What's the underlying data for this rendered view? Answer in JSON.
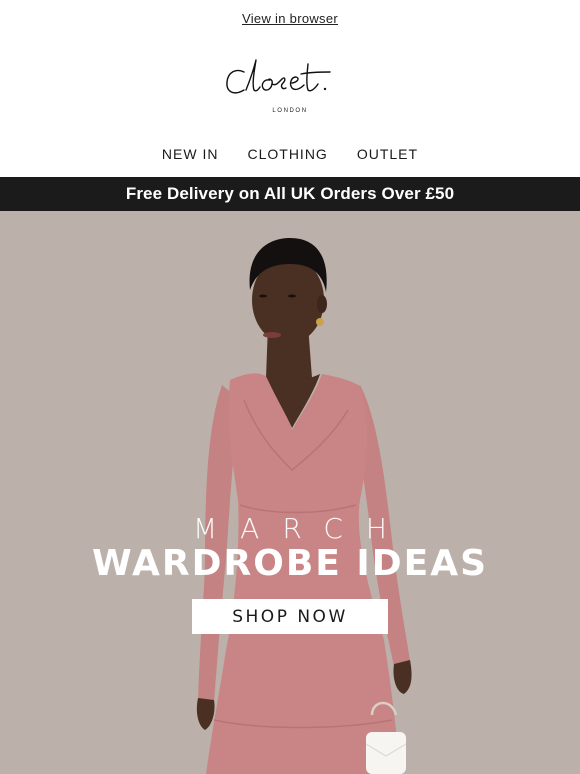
{
  "header": {
    "view_in_browser": "View in browser",
    "logo": {
      "wordmark": "Closet.",
      "sublabel": "LONDON"
    }
  },
  "nav": {
    "items": [
      {
        "label": "NEW IN"
      },
      {
        "label": "CLOTHING"
      },
      {
        "label": "OUTLET"
      }
    ]
  },
  "promo_bar": {
    "text": "Free Delivery on All UK Orders Over £50"
  },
  "hero": {
    "kicker": "MARCH",
    "title": "WARDROBE IDEAS",
    "cta_label": "SHOP NOW"
  },
  "colors": {
    "promo_bg": "#1b1b1b",
    "hero_bg": "#bcb0aa",
    "dress": "#c98585",
    "skin": "#4a2f23"
  }
}
